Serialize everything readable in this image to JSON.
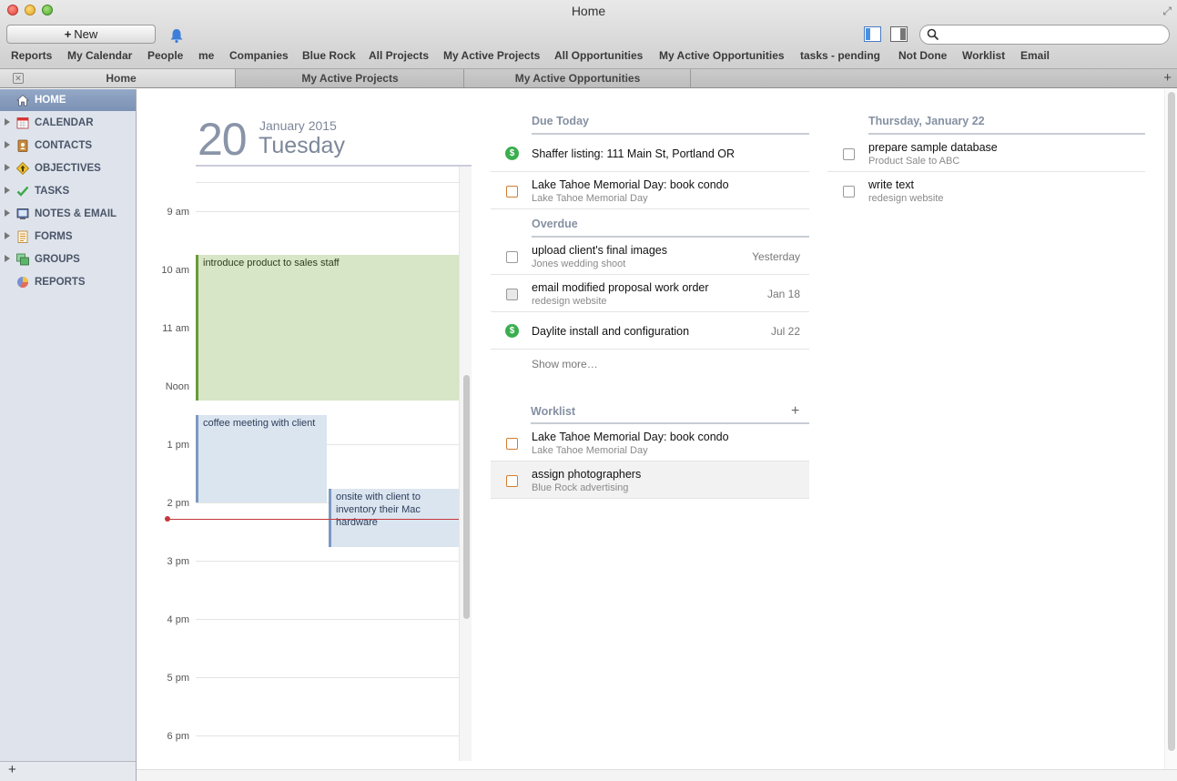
{
  "window": {
    "title": "Home"
  },
  "toolbar": {
    "new_label": "New",
    "new_icon": "plus-icon",
    "search_placeholder": ""
  },
  "bookmarks": [
    "Reports",
    "My Calendar",
    "People",
    "me",
    "Companies",
    "Blue Rock",
    "All Projects",
    "My Active Projects",
    "All Opportunities",
    "My Active Opportunities",
    "tasks - pending",
    "Not Done",
    "Worklist",
    "Email"
  ],
  "tabs": [
    {
      "label": "Home",
      "active": true
    },
    {
      "label": "My Active Projects",
      "active": false
    },
    {
      "label": "My Active Opportunities",
      "active": false
    }
  ],
  "sidebar": {
    "items": [
      {
        "label": "HOME",
        "icon": "house-icon"
      },
      {
        "label": "CALENDAR",
        "icon": "calendar-icon"
      },
      {
        "label": "CONTACTS",
        "icon": "address-book-icon"
      },
      {
        "label": "OBJECTIVES",
        "icon": "objectives-icon"
      },
      {
        "label": "TASKS",
        "icon": "checkmark-icon"
      },
      {
        "label": "NOTES & EMAIL",
        "icon": "notes-icon"
      },
      {
        "label": "FORMS",
        "icon": "form-icon"
      },
      {
        "label": "GROUPS",
        "icon": "groups-icon"
      },
      {
        "label": "REPORTS",
        "icon": "pie-chart-icon"
      }
    ]
  },
  "calendar": {
    "day_number": "20",
    "month_year": "January 2015",
    "weekday": "Tuesday",
    "hours": [
      "9 am",
      "10 am",
      "11 am",
      "Noon",
      "1 pm",
      "2 pm",
      "3 pm",
      "4 pm",
      "5 pm",
      "6 pm"
    ],
    "events": [
      {
        "title": "introduce product to sales staff",
        "color": "#d6e6c6"
      },
      {
        "title": "coffee meeting with client",
        "color": "#dbe5f0"
      },
      {
        "title": "onsite with client to inventory their Mac hardware",
        "color": "#dbe5f0"
      }
    ]
  },
  "due_today": {
    "title": "Due Today",
    "items": [
      {
        "title": "Shaffer listing: 111 Main St, Portland OR",
        "sub": "",
        "icon": "dollar-icon"
      },
      {
        "title": "Lake Tahoe Memorial Day: book condo",
        "sub": "Lake Tahoe Memorial Day",
        "icon": "checkbox-orange"
      }
    ]
  },
  "overdue": {
    "title": "Overdue",
    "items": [
      {
        "title": "upload client's final images",
        "sub": "Jones wedding shoot",
        "date": "Yesterday",
        "icon": "checkbox"
      },
      {
        "title": "email modified proposal work order",
        "sub": "redesign website",
        "date": "Jan 18",
        "icon": "checkbox-grey"
      },
      {
        "title": "Daylite install and configuration",
        "sub": "",
        "date": "Jul 22",
        "icon": "dollar-icon"
      }
    ],
    "show_more": "Show more…"
  },
  "worklist": {
    "title": "Worklist",
    "items": [
      {
        "title": "Lake Tahoe Memorial Day: book condo",
        "sub": "Lake Tahoe Memorial Day"
      },
      {
        "title": "assign photographers",
        "sub": "Blue Rock advertising"
      }
    ]
  },
  "upcoming": {
    "title": "Thursday, January 22",
    "items": [
      {
        "title": "prepare sample database",
        "sub": "Product Sale to ABC"
      },
      {
        "title": "write text",
        "sub": "redesign website"
      }
    ]
  }
}
